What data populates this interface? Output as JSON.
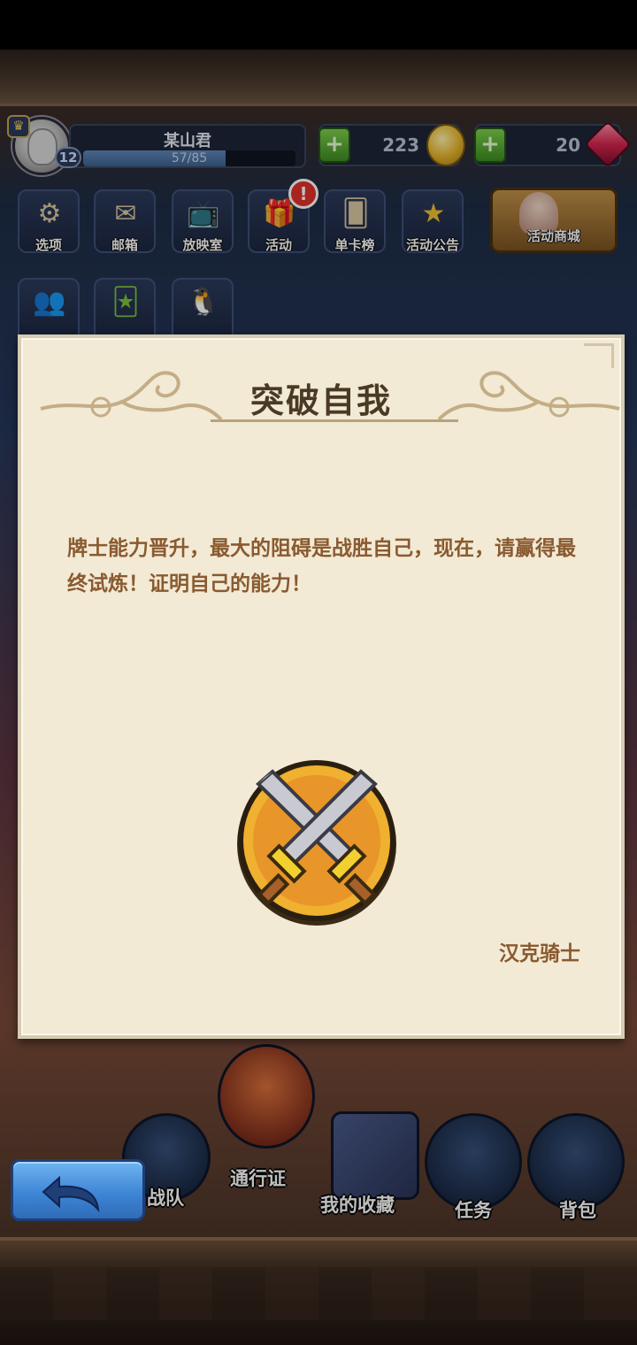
{
  "player": {
    "name": "某山君",
    "level": "12",
    "xp_text": "57/85",
    "xp_fraction": 0.67
  },
  "currencies": {
    "coins": "223",
    "gems": "20"
  },
  "menu": [
    {
      "label": "选项",
      "icon": "gear-icon"
    },
    {
      "label": "邮箱",
      "icon": "mail-icon"
    },
    {
      "label": "放映室",
      "icon": "tv-icon"
    },
    {
      "label": "活动",
      "icon": "gift-icon"
    },
    {
      "label": "单卡榜",
      "icon": "card-icon"
    },
    {
      "label": "活动公告",
      "icon": "star-notice-icon"
    }
  ],
  "alert_badge": "!",
  "shop": {
    "label": "活动商城"
  },
  "dialog": {
    "title": "突破自我",
    "body": "牌士能力晋升，最大的阻碍是战胜自己，现在，请赢得最终试炼！证明自己的能力！",
    "signature": "汉克骑士",
    "emblem": "crossed-swords-icon"
  },
  "bottom_nav": {
    "team": "战队",
    "pass": "通行证",
    "collection": "我的收藏",
    "tasks": "任务",
    "bag": "背包"
  },
  "colors": {
    "dialog_bg": "#f2ead5",
    "title_text": "#4a3a24",
    "body_text": "#8a5a30",
    "back_button": "#3f86d6"
  }
}
